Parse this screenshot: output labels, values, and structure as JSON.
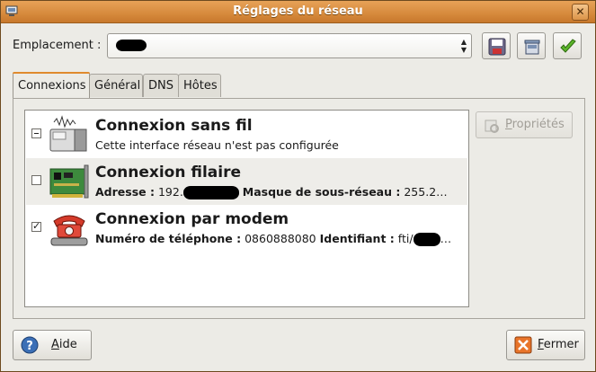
{
  "window": {
    "title": "Réglages du réseau"
  },
  "location": {
    "label": "Emplacement :",
    "selected_value": ""
  },
  "tabs": [
    {
      "label": "Connexions",
      "active": true
    },
    {
      "label": "Général",
      "active": false
    },
    {
      "label": "DNS",
      "active": false
    },
    {
      "label": "Hôtes",
      "active": false
    }
  ],
  "connections": [
    {
      "name": "Connexion sans fil",
      "detail": "Cette interface réseau n'est pas configurée",
      "state": "inconsistent",
      "icon": "wireless-card-icon"
    },
    {
      "name": "Connexion filaire",
      "address_label": "Adresse :",
      "address_value": "192.",
      "mask_label": "Masque de sous-réseau :",
      "mask_value": "255.2…",
      "state": "unchecked",
      "icon": "ethernet-card-icon"
    },
    {
      "name": "Connexion par modem",
      "phone_label": "Numéro de téléphone :",
      "phone_value": "0860888080",
      "id_label": "Identifiant :",
      "id_value": "fti/",
      "id_suffix": "…",
      "state": "checked",
      "icon": "telephone-modem-icon"
    }
  ],
  "buttons": {
    "properties_first": "P",
    "properties_rest": "ropriétés",
    "help_first": "A",
    "help_rest": "ide",
    "close_first": "F",
    "close_rest": "ermer"
  },
  "colors": {
    "titlebar": "#d68a3c",
    "active_tab_accent": "#e08a2e",
    "list_alt_row": "#eeede9"
  }
}
